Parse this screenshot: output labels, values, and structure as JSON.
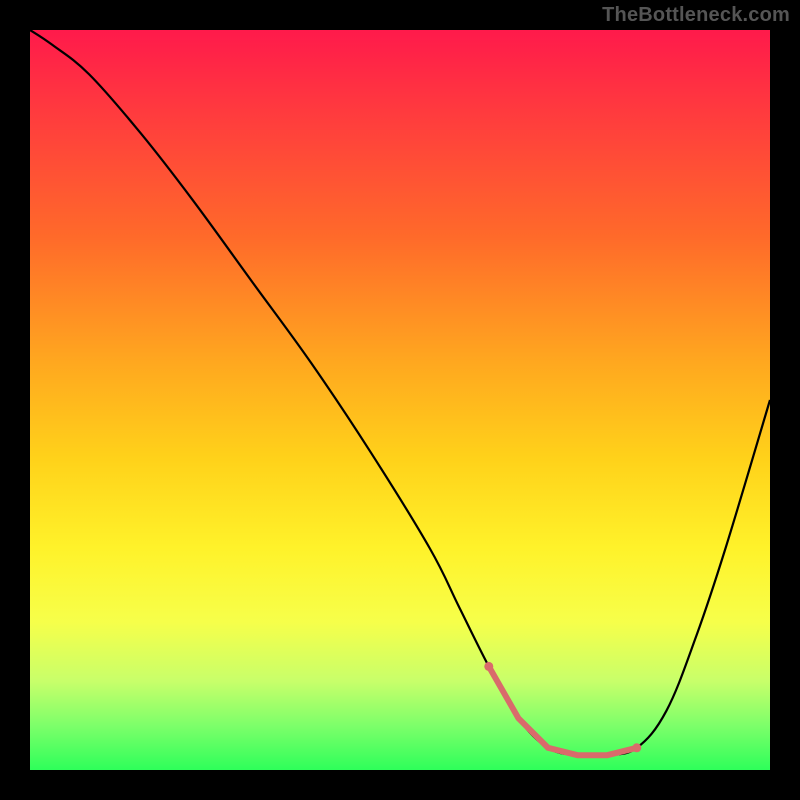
{
  "watermark": "TheBottleneck.com",
  "chart_data": {
    "type": "line",
    "title": "",
    "xlabel": "",
    "ylabel": "",
    "xlim": [
      0,
      100
    ],
    "ylim": [
      0,
      100
    ],
    "grid": false,
    "legend": false,
    "series": [
      {
        "name": "bottleneck-curve",
        "x": [
          0,
          3,
          8,
          15,
          22,
          30,
          38,
          46,
          54,
          58,
          62,
          66,
          70,
          74,
          78,
          82,
          86,
          90,
          94,
          100
        ],
        "values": [
          100,
          98,
          94,
          86,
          77,
          66,
          55,
          43,
          30,
          22,
          14,
          7,
          3,
          2,
          2,
          3,
          8,
          18,
          30,
          50
        ]
      }
    ],
    "highlight_zone": {
      "x_start": 62,
      "x_end": 82
    },
    "background_gradient": {
      "orientation": "vertical",
      "stops": [
        {
          "pos": 0.0,
          "color": "#ff1a4b"
        },
        {
          "pos": 0.28,
          "color": "#ff6a2a"
        },
        {
          "pos": 0.58,
          "color": "#ffd21a"
        },
        {
          "pos": 0.8,
          "color": "#f6ff4a"
        },
        {
          "pos": 1.0,
          "color": "#2eff5a"
        }
      ]
    }
  }
}
